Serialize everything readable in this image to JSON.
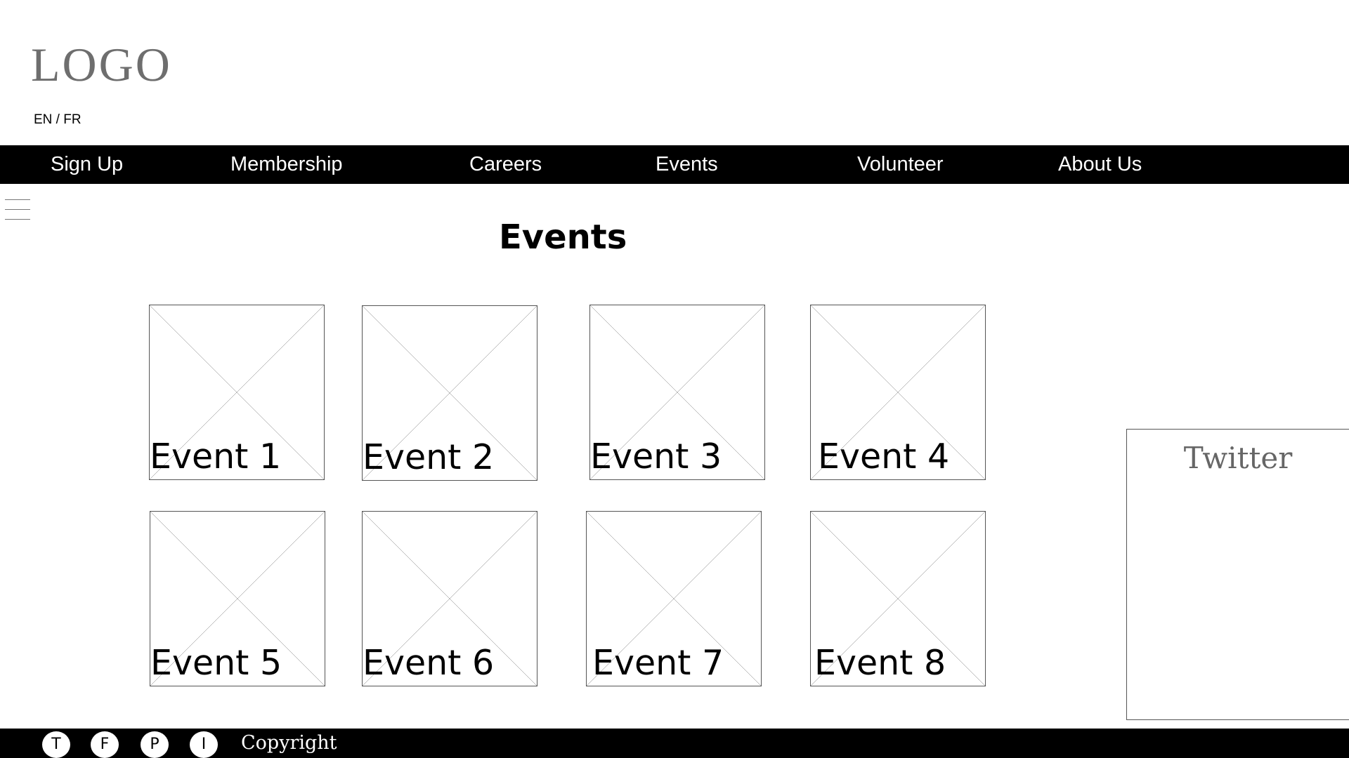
{
  "header": {
    "logo": "LOGO",
    "language_toggle": "EN / FR"
  },
  "nav": {
    "items": [
      {
        "label": "Sign Up"
      },
      {
        "label": "Membership"
      },
      {
        "label": "Careers"
      },
      {
        "label": "Events"
      },
      {
        "label": "Volunteer"
      },
      {
        "label": "About Us"
      }
    ]
  },
  "main": {
    "title": "Events",
    "events": [
      {
        "label": "Event 1"
      },
      {
        "label": "Event 2"
      },
      {
        "label": "Event 3"
      },
      {
        "label": "Event 4"
      },
      {
        "label": "Event 5"
      },
      {
        "label": "Event 6"
      },
      {
        "label": "Event 7"
      },
      {
        "label": "Event 8"
      }
    ]
  },
  "sidebar": {
    "twitter_title": "Twitter"
  },
  "footer": {
    "social": [
      {
        "label": "T",
        "icon": "twitter-icon"
      },
      {
        "label": "F",
        "icon": "facebook-icon"
      },
      {
        "label": "P",
        "icon": "pinterest-icon"
      },
      {
        "label": "I",
        "icon": "instagram-icon"
      }
    ],
    "copyright": "Copyright"
  },
  "colors": {
    "nav_background": "#000000",
    "nav_text": "#ffffff",
    "logo": "#6e6e6e"
  }
}
